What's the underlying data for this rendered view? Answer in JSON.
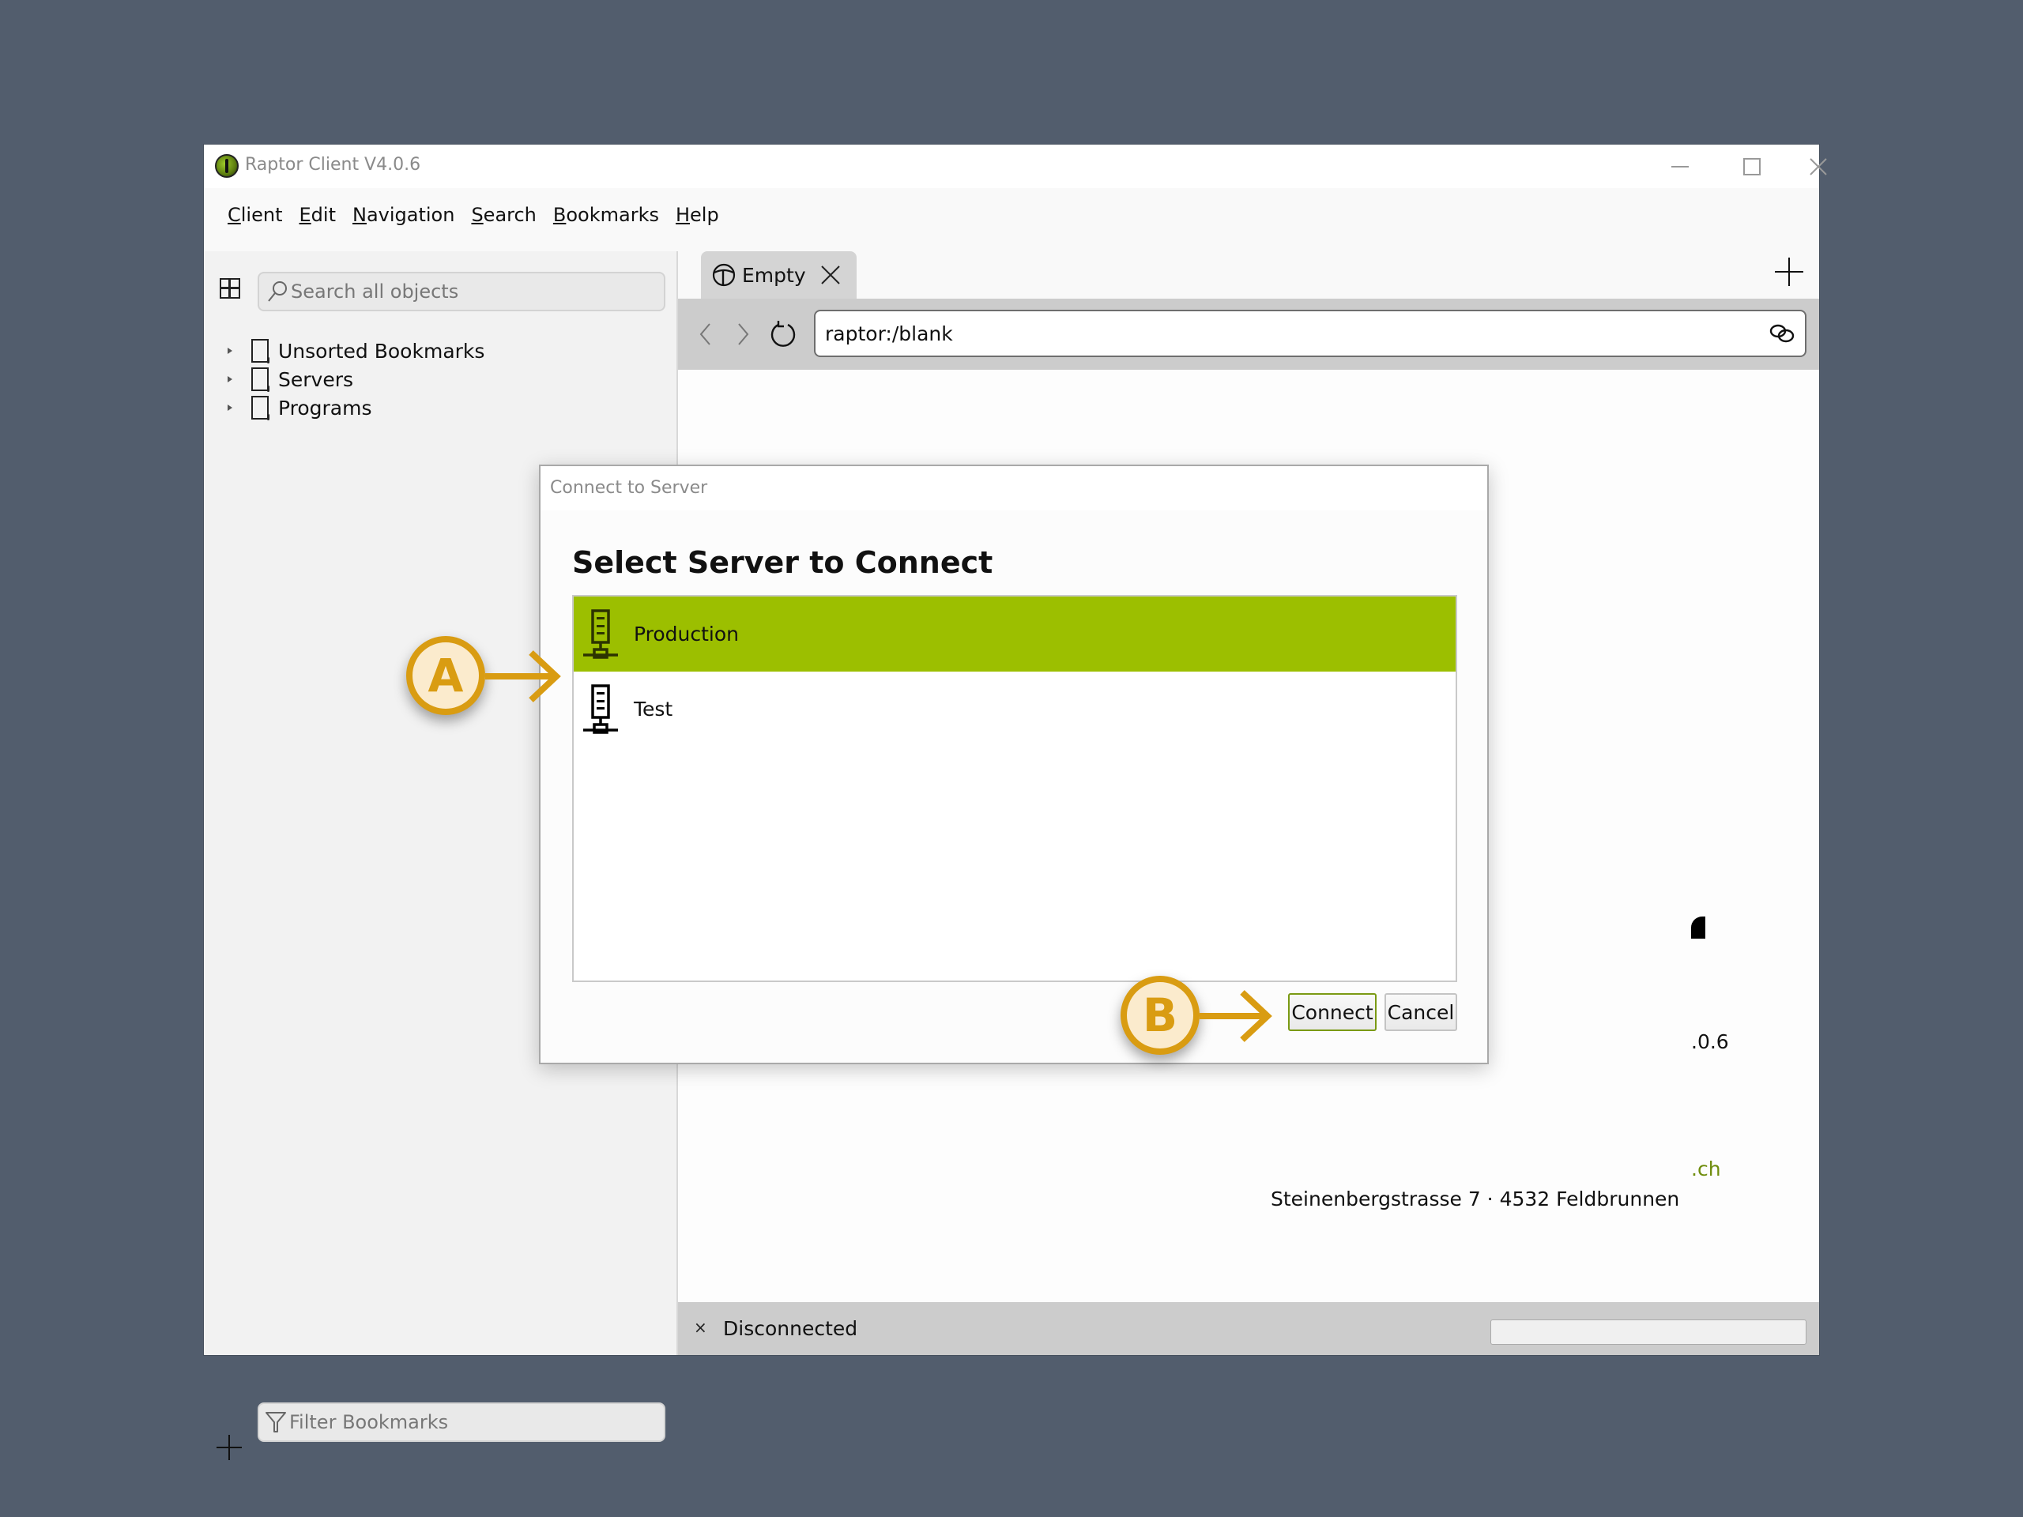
{
  "window": {
    "title": "Raptor Client V4.0.6",
    "controls": {
      "minimize": "minimize",
      "maximize": "maximize",
      "close": "close"
    }
  },
  "menu": [
    {
      "accel": "C",
      "rest": "lient"
    },
    {
      "accel": "E",
      "rest": "dit"
    },
    {
      "accel": "N",
      "rest": "avigation"
    },
    {
      "accel": "S",
      "rest": "earch"
    },
    {
      "accel": "B",
      "rest": "ookmarks"
    },
    {
      "accel": "H",
      "rest": "elp"
    }
  ],
  "sidebar": {
    "search_placeholder": "Search all objects",
    "tree": [
      {
        "label": "Unsorted Bookmarks"
      },
      {
        "label": "Servers"
      },
      {
        "label": "Programs"
      }
    ],
    "filter_placeholder": "Filter Bookmarks"
  },
  "tabs": [
    {
      "label": "Empty",
      "icon": "raptor-globe-icon"
    }
  ],
  "toolbar": {
    "url": "raptor:/blank"
  },
  "background_page": {
    "version_fragment": ".0.6",
    "web_fragment": ".ch",
    "address": "Steinenbergstrasse 7 · 4532 Feldbrunnen"
  },
  "status": {
    "icon": "×",
    "text": "Disconnected"
  },
  "dialog": {
    "title": "Connect to Server",
    "heading": "Select Server to Connect",
    "servers": [
      {
        "label": "Production",
        "selected": true
      },
      {
        "label": "Test",
        "selected": false
      }
    ],
    "connect_label": "Connect",
    "cancel_label": "Cancel"
  },
  "callouts": {
    "a": "A",
    "b": "B"
  },
  "colors": {
    "selection": "#9cbf00",
    "callout": "#d99c12",
    "callout_fill": "#fbebcd",
    "desktop": "#525d6d"
  }
}
